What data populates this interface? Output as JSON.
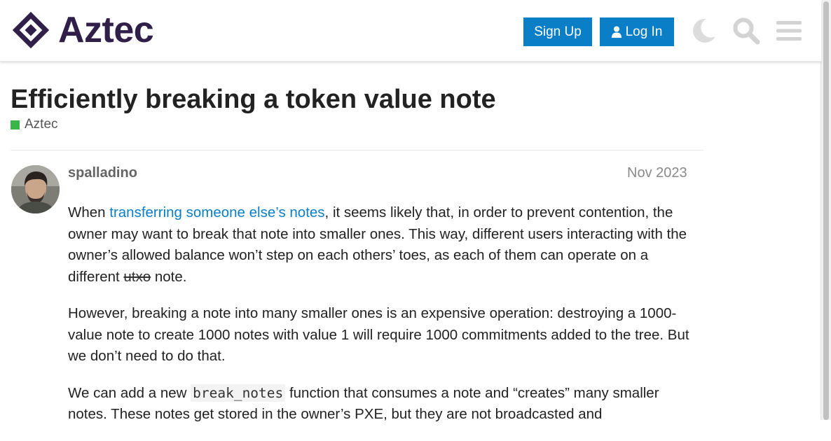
{
  "brand": {
    "name": "Aztec"
  },
  "header": {
    "signup_label": "Sign Up",
    "login_label": "Log In",
    "icons": [
      "moon-icon",
      "search-icon",
      "hamburger-menu-icon"
    ]
  },
  "topic": {
    "title": "Efficiently breaking a token value note",
    "category": "Aztec",
    "category_color": "#3ab54a"
  },
  "post": {
    "username": "spalladino",
    "date": "Nov 2023",
    "p1": {
      "before": "When ",
      "link": "transferring someone else’s notes",
      "after": ", it seems likely that, in order to prevent contention, the owner may want to break that note into smaller ones. This way, different users interacting with the owner’s allowed balance won’t step on each others’ toes, as each of them can operate on a different ",
      "struck": "utxo",
      "end": " note."
    },
    "p2": "However, breaking a note into many smaller ones is an expensive operation: destroying a 1000-value note to create 1000 notes with value 1 will require 1000 commitments added to the tree. But we don’t need to do that.",
    "p3": {
      "before": "We can add a new ",
      "code": "break_notes",
      "after": " function that consumes a note and “creates” many smaller notes. These notes get stored in the owner’s PXE, but they are not broadcasted and"
    }
  },
  "colors": {
    "brand": "#2f1f49",
    "accent": "#0a7fc8",
    "text": "#222222",
    "muted": "#646464"
  }
}
